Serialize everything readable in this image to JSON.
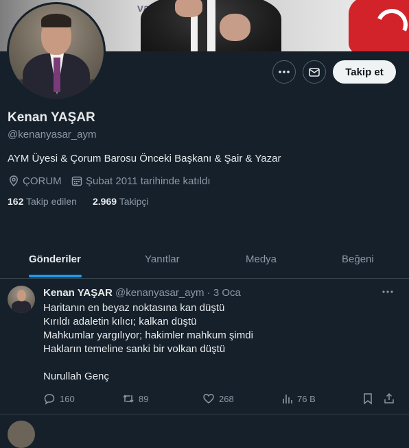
{
  "profile": {
    "name": "Kenan YAŞAR",
    "handle": "@kenanyasar_aym",
    "bio": "AYM Üyesi & Çorum Barosu Önceki Başkanı & Şair & Yazar",
    "location": "ÇORUM",
    "joined": "Şubat 2011 tarihinde katıldı",
    "following_count": "162",
    "following_label": "Takip edilen",
    "followers_count": "2.969",
    "followers_label": "Takipçi",
    "banner_text": "va"
  },
  "actions": {
    "more_icon": "more-icon",
    "message_icon": "mail-icon",
    "follow_label": "Takip et"
  },
  "tabs": [
    {
      "label": "Gönderiler",
      "active": true
    },
    {
      "label": "Yanıtlar",
      "active": false
    },
    {
      "label": "Medya",
      "active": false
    },
    {
      "label": "Beğeni",
      "active": false
    }
  ],
  "post": {
    "author_name": "Kenan YAŞAR",
    "author_handle": "@kenanyasar_aym",
    "date": "· 3 Oca",
    "lines": [
      "Haritanın en beyaz noktasına kan düştü",
      "Kırıldı adaletin kılıcı; kalkan düştü",
      "Mahkumlar yargılıyor; hakimler mahkum şimdi",
      "Hakların temeline sanki bir volkan düştü",
      "",
      "Nurullah Genç"
    ],
    "replies": "160",
    "reposts": "89",
    "likes": "268",
    "views": "76 B"
  },
  "colors": {
    "background": "#15202b",
    "accent": "#1d9bf0",
    "muted": "#8b98a5"
  }
}
